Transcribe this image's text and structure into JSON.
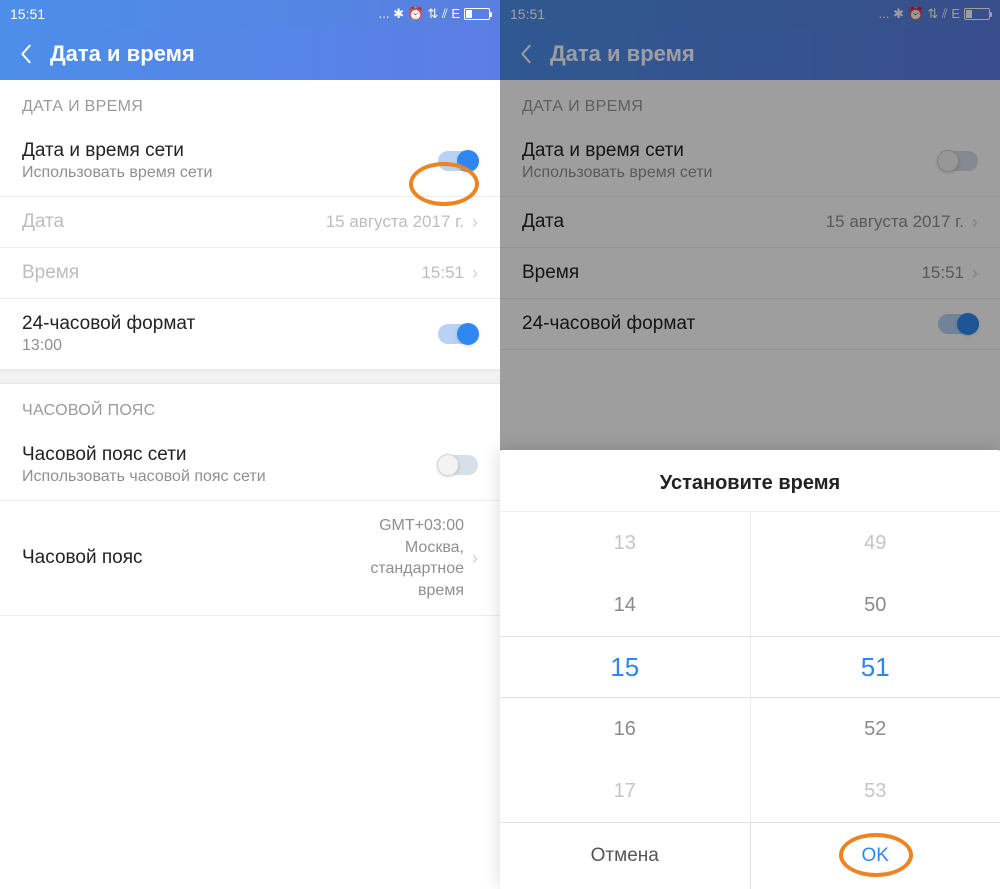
{
  "status": {
    "time": "15:51",
    "icons": "...  ✱ ⏰  ⇅  ⫽  E"
  },
  "header": {
    "title": "Дата и время"
  },
  "section1": {
    "header": "ДАТА И ВРЕМЯ"
  },
  "rows": {
    "net_time": {
      "title": "Дата и время сети",
      "sub": "Использовать время сети"
    },
    "date": {
      "title": "Дата",
      "value": "15 августа 2017 г."
    },
    "time": {
      "title": "Время",
      "value": "15:51"
    },
    "fmt24": {
      "title": "24-часовой формат",
      "sub": "13:00"
    }
  },
  "section2": {
    "header": "ЧАСОВОЙ ПОЯС"
  },
  "rows2": {
    "net_tz": {
      "title": "Часовой пояс сети",
      "sub": "Использовать часовой пояс сети"
    },
    "tz": {
      "title": "Часовой пояс",
      "value": "GMT+03:00\nМосква,\nстандартное\nвремя"
    }
  },
  "modal": {
    "title": "Установите время",
    "hours": [
      "13",
      "14",
      "15",
      "16",
      "17"
    ],
    "minutes": [
      "49",
      "50",
      "51",
      "52",
      "53"
    ],
    "cancel": "Отмена",
    "ok": "OK"
  }
}
